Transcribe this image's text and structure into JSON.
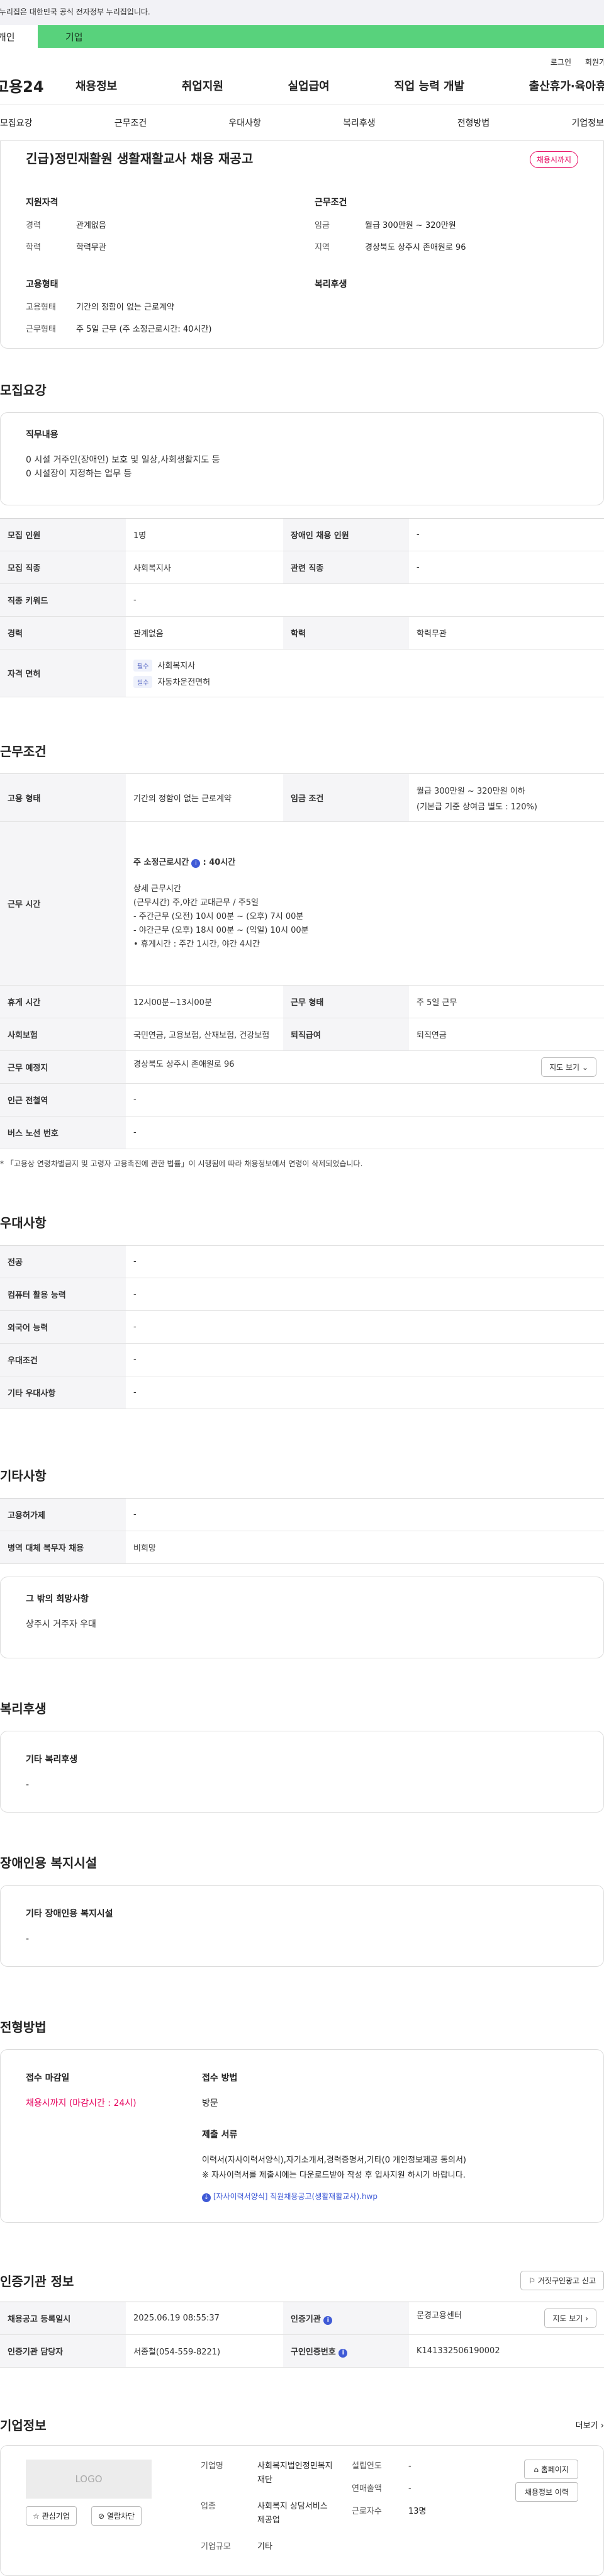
{
  "topbar": {
    "gov_notice": "이 누리집은 대한민국 공식 전자정부 누리집입니다."
  },
  "audience": {
    "tab_a": "개인",
    "tab_b": "기업"
  },
  "util": {
    "login": "로그인",
    "signup": "회원가입"
  },
  "gnb": {
    "logo": "고용24",
    "menu": [
      "채용정보",
      "취업지원",
      "실업급여",
      "직업 능력 개발",
      "출산휴가·육아휴직"
    ]
  },
  "subnav": [
    "모집요강",
    "근무조건",
    "우대사항",
    "복리후생",
    "전형방법",
    "기업정보"
  ],
  "job": {
    "title": "긴급)정민재활원 생활재활교사 채용 재공고",
    "badge": "채용시까지",
    "qual_head": "지원자격",
    "qual": [
      {
        "k": "경력",
        "v": "관계없음"
      },
      {
        "k": "학력",
        "v": "학력무관"
      }
    ],
    "cond_head": "근무조건",
    "cond": [
      {
        "k": "임금",
        "v": "월급 300만원 ~ 320만원"
      },
      {
        "k": "지역",
        "v": "경상북도 상주시 존애원로 96"
      }
    ],
    "emp_head": "고용형태",
    "emp": [
      {
        "k": "고용형태",
        "v": "기간의 정함이 없는 근로계약"
      },
      {
        "k": "근무형태",
        "v": "주 5일 근무 (주 소정근로시간: 40시간)"
      }
    ],
    "welfare_head": "복리후생"
  },
  "recruit": {
    "title": "모집요강",
    "duty_head": "직무내용",
    "duty_lines": [
      "0 시설 거주인(장애인) 보호 및 일상,사회생활지도 등",
      "0 시설장이 지정하는 업무 등"
    ],
    "rows": {
      "r1k": "모집 인원",
      "r1v": "1명",
      "r1k2": "장애인 채용 인원",
      "r1v2": "-",
      "r2k": "모집 직종",
      "r2v": "사회복지사",
      "r2k2": "관련 직종",
      "r2v2": "-",
      "r3k": "직종 키워드",
      "r3v": "-",
      "r4k": "경력",
      "r4v": "관계없음",
      "r4k2": "학력",
      "r4v2": "학력무관",
      "r5k": "자격 면허",
      "chip": "필수",
      "lic1": "사회복지사",
      "lic2": "자동차운전면허"
    }
  },
  "work": {
    "title": "근무조건",
    "rows": {
      "t1k": "고용 형태",
      "t1v": "기간의 정함이 없는 근로계약",
      "t1k2": "임금 조건",
      "t1v2a": "월급 300만원 ~ 320만원 이하",
      "t1v2b": "(기본급 기준 상여금 별도 : 120%)",
      "t2k": "근무 시간",
      "hours_head": "주 소정근로시간",
      "hours_val": ": 40시간",
      "detail_head": "상세 근무시간",
      "detail_lines": [
        "(근무시간) 주,야간 교대근무 / 주5일",
        "- 주간근무 (오전) 10시 00분 ~ (오후) 7시 00분",
        "- 야간근무 (오후) 18시 00분 ~ (익일) 10시 00분",
        "• 휴게시간 : 주간 1시간, 야간 4시간"
      ],
      "t3k": "휴게 시간",
      "t3v": "12시00분~13시00분",
      "t3k2": "근무 형태",
      "t3v2": "주 5일 근무",
      "t4k": "사회보험",
      "t4v": "국민연금, 고용보험, 산재보험, 건강보험",
      "t4k2": "퇴직급여",
      "t4v2": "퇴직연금",
      "t5k": "근무 예정지",
      "t5v": "경상북도 상주시 존애원로 96",
      "map": "지도 보기",
      "t6k": "인근 전철역",
      "t6v": "-",
      "t7k": "버스 노선 번호",
      "t7v": "-"
    },
    "note": "* 「고용상 연령차별금지 및 고령자 고용촉진에 관한 법률」이 시행됨에 따라 채용정보에서 연령이 삭제되었습니다."
  },
  "pref": {
    "title": "우대사항",
    "rows": [
      {
        "k": "전공",
        "v": "-"
      },
      {
        "k": "컴퓨터 활용 능력",
        "v": "-"
      },
      {
        "k": "외국어 능력",
        "v": "-"
      },
      {
        "k": "우대조건",
        "v": "-"
      },
      {
        "k": "기타 우대사항",
        "v": "-"
      }
    ]
  },
  "etc": {
    "title": "기타사항",
    "rows": [
      {
        "k": "고용허가제",
        "v": "-"
      },
      {
        "k": "병역 대체 복무자 채용",
        "v": "비희망"
      }
    ],
    "other_head": "그 밖의 희망사항",
    "other_val": "상주시 거주자 우대"
  },
  "welfare": {
    "title": "복리후생",
    "head": "기타 복리후생",
    "val": "-"
  },
  "disab": {
    "title": "장애인용 복지시설",
    "head": "기타 장애인용 복지시설",
    "val": "-"
  },
  "process": {
    "title": "전형방법",
    "deadline_head": "접수 마감일",
    "deadline_val": "채용시까지 (마감시간 : 24시)",
    "method_head": "접수 방법",
    "method_val": "방문",
    "docs_head": "제출 서류",
    "docs_lines": [
      "이력서(자사이력서양식),자기소개서,경력증명서,기타(0 개인정보제공 동의서)",
      "※ 자사이력서를 제출시에는 다운로드받아 작성 후 입사지원 하시기 바랍니다."
    ],
    "file": "[자사이력서양식] 직원채용공고(생활재활교사).hwp"
  },
  "agency": {
    "title": "인증기관 정보",
    "report_btn": "거짓구인광고 신고",
    "rows": {
      "a1k": "채용공고 등록일시",
      "a1v": "2025.06.19 08:55:37",
      "a1k2": "인증기관",
      "a1v2": "문경고용센터",
      "map": "지도 보기",
      "a2k": "인증기관 담당자",
      "a2v": "서종철(054-559-8221)",
      "a2k2": "구인인증번호",
      "a2v2": "K141332506190002"
    }
  },
  "company": {
    "title": "기업정보",
    "more": "더보기",
    "logo": "LOGO",
    "fav_btn": "관심기업",
    "block_btn": "열람차단",
    "k_name": "기업명",
    "v_name": "사회복지법인정민복지재단",
    "k_ind": "업종",
    "v_ind": "사회복지 상담서비스 제공업",
    "k_size": "기업규모",
    "v_size": "기타",
    "k_est": "설립연도",
    "v_est": "-",
    "k_rev": "연매출액",
    "v_rev": "-",
    "k_emp": "근로자수",
    "v_emp": "13명",
    "home_btn": "홈페이지",
    "jobs_btn": "채용정보 이력"
  }
}
